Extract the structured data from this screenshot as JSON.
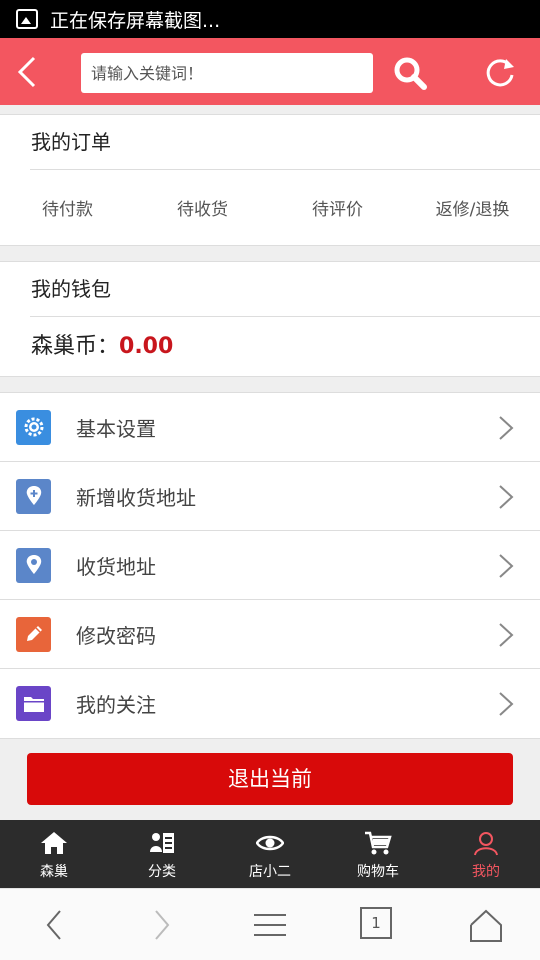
{
  "status_bar": {
    "text": "正在保存屏幕截图..."
  },
  "header": {
    "search_placeholder": "请输入关键词！"
  },
  "orders": {
    "title": "我的订单",
    "tabs": [
      "待付款",
      "待收货",
      "待评价",
      "返修/退换"
    ]
  },
  "wallet": {
    "title": "我的钱包",
    "coin_label": "森巢币：",
    "coin_value": "0.00"
  },
  "menu": [
    {
      "label": "基本设置",
      "icon": "gear-icon",
      "color": "#3a8ee0"
    },
    {
      "label": "新增收货地址",
      "icon": "add-location-icon",
      "color": "#5b86c9"
    },
    {
      "label": "收货地址",
      "icon": "location-icon",
      "color": "#5b86c9"
    },
    {
      "label": "修改密码",
      "icon": "pencil-icon",
      "color": "#e8653a"
    },
    {
      "label": "我的关注",
      "icon": "folder-icon",
      "color": "#6a45c7"
    }
  ],
  "logout": {
    "label": "退出当前"
  },
  "tabbar": {
    "items": [
      {
        "label": "森巢",
        "icon": "home-icon"
      },
      {
        "label": "分类",
        "icon": "category-icon"
      },
      {
        "label": "店小二",
        "icon": "eye-icon"
      },
      {
        "label": "购物车",
        "icon": "cart-icon"
      },
      {
        "label": "我的",
        "icon": "user-icon",
        "active": true
      }
    ]
  },
  "browser": {
    "tab_count": "1"
  },
  "colors": {
    "header": "#f35660",
    "accent": "#d80a0a",
    "tabbar": "#2c2c2c"
  }
}
